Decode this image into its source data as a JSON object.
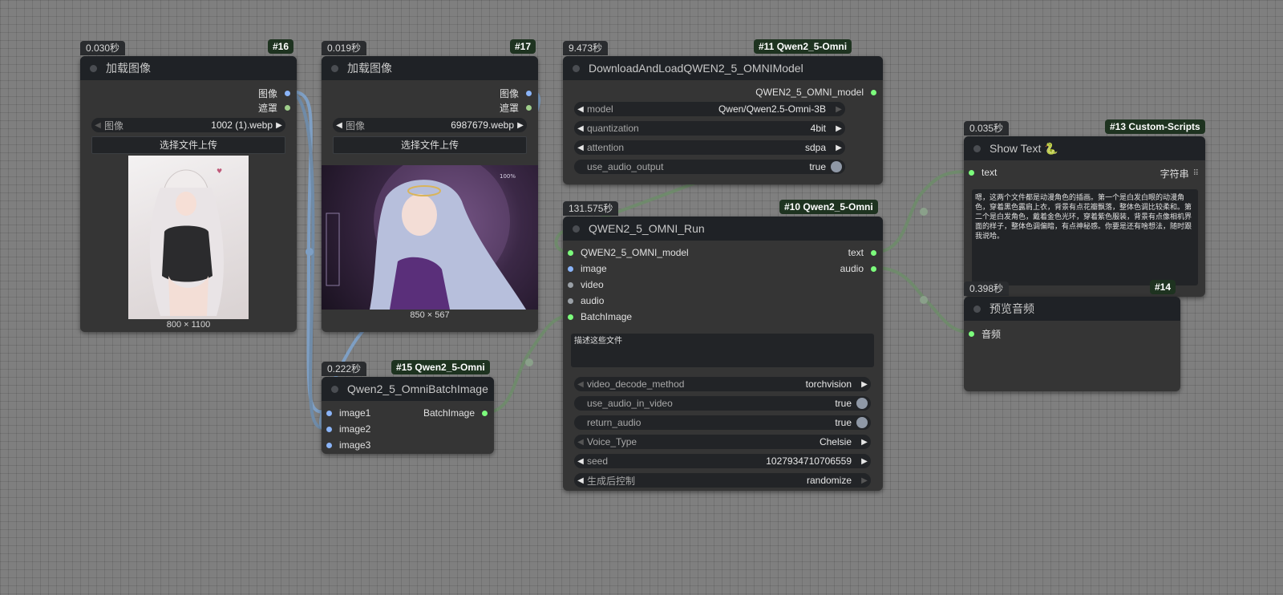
{
  "colors": {
    "canvas": "#7f7f7f",
    "node_body": "#353535",
    "node_title": "#1f2226",
    "badge_bg": "#1e3320",
    "link_image": "#7e9fc4",
    "link_other": "#6f8a6c"
  },
  "node16": {
    "timer": "0.030秒",
    "badge": "#16",
    "title": "加载图像",
    "out1": "图像",
    "out2": "遮罩",
    "image_label": "图像",
    "image_value": "1002 (1).webp",
    "upload": "选择文件上传",
    "dims": "800 × 1100"
  },
  "node17": {
    "timer": "0.019秒",
    "badge": "#17",
    "title": "加载图像",
    "out1": "图像",
    "out2": "遮罩",
    "image_label": "图像",
    "image_value": "6987679.webp",
    "upload": "选择文件上传",
    "dims": "850 × 567"
  },
  "node11": {
    "timer": "9.473秒",
    "badge": "#11 Qwen2_5-Omni",
    "title": "DownloadAndLoadQWEN2_5_OMNIModel",
    "out1": "QWEN2_5_OMNI_model",
    "w_model_label": "model",
    "w_model_value": "Qwen/Qwen2.5-Omni-3B",
    "w_quant_label": "quantization",
    "w_quant_value": "4bit",
    "w_attn_label": "attention",
    "w_attn_value": "sdpa",
    "w_audio_label": "use_audio_output",
    "w_audio_value": "true"
  },
  "node10": {
    "timer": "131.575秒",
    "badge": "#10 Qwen2_5-Omni",
    "title": "QWEN2_5_OMNI_Run",
    "in1": "QWEN2_5_OMNI_model",
    "in2": "image",
    "in3": "video",
    "in4": "audio",
    "in5": "BatchImage",
    "out1": "text",
    "out2": "audio",
    "prompt": "描述这些文件",
    "w_vdm_label": "video_decode_method",
    "w_vdm_value": "torchvision",
    "w_uaiv_label": "use_audio_in_video",
    "w_uaiv_value": "true",
    "w_ra_label": "return_audio",
    "w_ra_value": "true",
    "w_voice_label": "Voice_Type",
    "w_voice_value": "Chelsie",
    "w_seed_label": "seed",
    "w_seed_value": "1027934710706559",
    "w_ctrl_label": "生成后控制",
    "w_ctrl_value": "randomize"
  },
  "node15": {
    "timer": "0.222秒",
    "badge": "#15 Qwen2_5-Omni",
    "title": "Qwen2_5_OmniBatchImage",
    "in1": "image1",
    "in2": "image2",
    "in3": "image3",
    "out1": "BatchImage"
  },
  "node13": {
    "timer": "0.035秒",
    "badge": "#13 Custom-Scripts",
    "title": "Show Text 🐍",
    "in1": "text",
    "widget_type": "字符串",
    "text": "嗯，这两个文件都是动漫角色的插画。第一个是白发白眼的动漫角色，穿着黑色露肩上衣，背景有点花瓣飘落，整体色调比较柔和。第二个是白发角色，戴着金色光环，穿着紫色服装，背景有点像相机界面的样子，整体色调偏暗，有点神秘感。你要是还有啥想法，随时跟我说哈。"
  },
  "node14": {
    "timer": "0.398秒",
    "badge": "#14",
    "title": "预览音频",
    "in1": "音频"
  }
}
